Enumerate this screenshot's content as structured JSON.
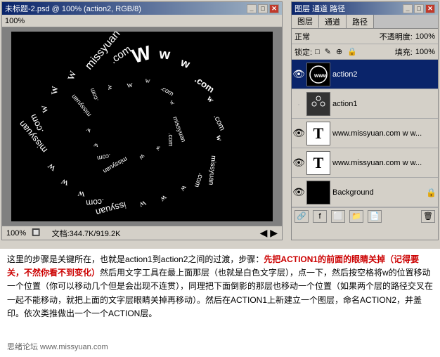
{
  "canvasWindow": {
    "title": "未标题-2.psd @ 100% (action2, RGB/8)",
    "zoomLevel": "100%",
    "docInfo": "文档:344.7K/919.2K"
  },
  "layersPanel": {
    "title": "图层 通道 路径",
    "tabs": [
      "图层",
      "通道",
      "路径"
    ],
    "controls": {
      "blendMode": "正常",
      "opacityLabel": "不透明度:",
      "opacityValue": "100%",
      "lockLabel": "锁定:",
      "fillLabel": "填充:",
      "fillValue": "100%"
    },
    "layers": [
      {
        "name": "action2",
        "type": "spiral",
        "visible": true,
        "selected": true
      },
      {
        "name": "action1",
        "type": "dots",
        "visible": false,
        "selected": false
      },
      {
        "name": "www.missyuan.com  w w...",
        "type": "text-white",
        "visible": true,
        "selected": false
      },
      {
        "name": "www.missyuan.com  w w...",
        "type": "text-white",
        "visible": true,
        "selected": false
      },
      {
        "name": "Background",
        "type": "black",
        "visible": true,
        "selected": false,
        "locked": true
      }
    ]
  },
  "bottomText": {
    "intro": "这里的步骤是关键所在，也就是action1到action2之间的过渡，步骤：先把ACTION1的前面的眼睛关掉（记得要关，不然你看不到变化）然后用文字工具在最上面那层（也就是白色文字层），点一下，然后按空格将w的位置移动一个位置（你可以移动几个但是会出现不连贯），同理把下面倒影的那层也移动一个位置（如果两个层的路径交叉在一起不能移动，就把上面的文字层眼睛关掉再移动）。然后在ACTION1上新建立一个图层，命名ACTION2，并盖印。依次类推做出一个一个ACTION层。",
    "highlightStart": "先把ACTION1的",
    "footer": "思绪论坛  www.missyuan.com"
  }
}
